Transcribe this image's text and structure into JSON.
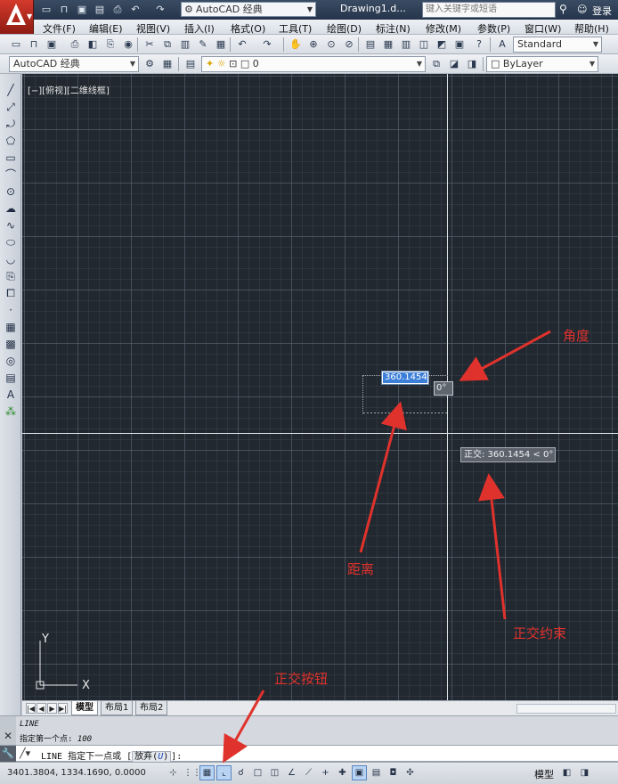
{
  "title_bar": {
    "workspace": "AutoCAD 经典",
    "document_title": "Drawing1.d...",
    "search_placeholder": "键入关键字或短语",
    "login": "登录"
  },
  "menu": [
    "文件(F)",
    "编辑(E)",
    "视图(V)",
    "插入(I)",
    "格式(O)",
    "工具(T)",
    "绘图(D)",
    "标注(N)",
    "修改(M)",
    "参数(P)",
    "窗口(W)",
    "帮助(H)"
  ],
  "toolbar": {
    "text_style": "Standard",
    "workspace_combo": "AutoCAD 经典",
    "layer": "0",
    "color": "ByLayer"
  },
  "viewport_label": "[−][俯视][二维线框]",
  "dynamic_input": {
    "distance": "360.1454",
    "angle": "0°",
    "tooltip": "正交: 360.1454 < 0°"
  },
  "ucs": {
    "x_label": "X",
    "y_label": "Y"
  },
  "annotations": {
    "angle": "角度",
    "distance": "距离",
    "ortho_constraint": "正交约束",
    "ortho_button": "正交按钮"
  },
  "tabs": [
    "模型",
    "布局1",
    "布局2"
  ],
  "command": {
    "history_line1": "LINE",
    "history_line2_prefix": "指定第一个点: ",
    "history_line2_value": "100",
    "prompt_prefix": "LINE 指定下一点或 [",
    "option_label": "放弃(",
    "option_key": "U",
    "option_suffix": ")",
    "prompt_suffix": "]:"
  },
  "status": {
    "coordinates": "3401.3804,  1334.1690,  0.0000",
    "model": "模型"
  },
  "colors": {
    "annotation": "#e0322c",
    "canvas_bg": "#212830",
    "titlebar": "#2c3b51"
  }
}
